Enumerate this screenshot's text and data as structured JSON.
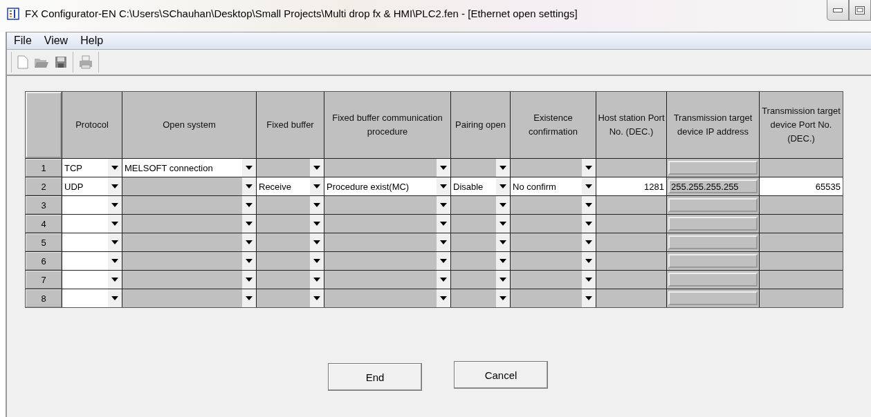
{
  "window": {
    "title": "FX Configurator-EN C:\\Users\\SChauhan\\Desktop\\Small Projects\\Multi drop fx & HMI\\PLC2.fen - [Ethernet open settings]"
  },
  "menu": [
    "File",
    "View",
    "Help"
  ],
  "table": {
    "columns": [
      {
        "label": "Protocol",
        "kind": "combo"
      },
      {
        "label": "Open system",
        "kind": "combo"
      },
      {
        "label": "Fixed buffer",
        "kind": "combo"
      },
      {
        "label": "Fixed buffer communication procedure",
        "kind": "combo"
      },
      {
        "label": "Pairing open",
        "kind": "combo"
      },
      {
        "label": "Existence confirmation",
        "kind": "combo"
      },
      {
        "label": "Host station Port No. (DEC.)",
        "kind": "number"
      },
      {
        "label": "Transmission target device IP address",
        "kind": "ip"
      },
      {
        "label": "Transmission target device Port No. (DEC.)",
        "kind": "number"
      }
    ],
    "rows": [
      {
        "number": "1",
        "cells": [
          {
            "value": "TCP",
            "enabled": true
          },
          {
            "value": "MELSOFT connection",
            "enabled": true
          },
          {
            "enabled": false
          },
          {
            "enabled": false
          },
          {
            "enabled": false
          },
          {
            "enabled": false
          },
          {
            "enabled": false
          },
          {
            "enabled": false
          },
          {
            "enabled": false
          }
        ]
      },
      {
        "number": "2",
        "cells": [
          {
            "value": "UDP",
            "enabled": true
          },
          {
            "enabled": false
          },
          {
            "value": "Receive",
            "enabled": true
          },
          {
            "value": "Procedure exist(MC)",
            "enabled": true
          },
          {
            "value": "Disable",
            "enabled": true
          },
          {
            "value": "No confirm",
            "enabled": true
          },
          {
            "value": "1281",
            "enabled": true
          },
          {
            "value": "255.255.255.255",
            "enabled": false
          },
          {
            "value": "65535",
            "enabled": true
          }
        ]
      },
      {
        "number": "3",
        "cells": [
          {
            "enabled": true
          },
          {
            "enabled": false
          },
          {
            "enabled": false
          },
          {
            "enabled": false
          },
          {
            "enabled": false
          },
          {
            "enabled": false
          },
          {
            "enabled": false
          },
          {
            "enabled": false
          },
          {
            "enabled": false
          }
        ]
      },
      {
        "number": "4",
        "cells": [
          {
            "enabled": true
          },
          {
            "enabled": false
          },
          {
            "enabled": false
          },
          {
            "enabled": false
          },
          {
            "enabled": false
          },
          {
            "enabled": false
          },
          {
            "enabled": false
          },
          {
            "enabled": false
          },
          {
            "enabled": false
          }
        ]
      },
      {
        "number": "5",
        "cells": [
          {
            "enabled": true
          },
          {
            "enabled": false
          },
          {
            "enabled": false
          },
          {
            "enabled": false
          },
          {
            "enabled": false
          },
          {
            "enabled": false
          },
          {
            "enabled": false
          },
          {
            "enabled": false
          },
          {
            "enabled": false
          }
        ]
      },
      {
        "number": "6",
        "cells": [
          {
            "enabled": true
          },
          {
            "enabled": false
          },
          {
            "enabled": false
          },
          {
            "enabled": false
          },
          {
            "enabled": false
          },
          {
            "enabled": false
          },
          {
            "enabled": false
          },
          {
            "enabled": false
          },
          {
            "enabled": false
          }
        ]
      },
      {
        "number": "7",
        "cells": [
          {
            "enabled": true
          },
          {
            "enabled": false
          },
          {
            "enabled": false
          },
          {
            "enabled": false
          },
          {
            "enabled": false
          },
          {
            "enabled": false
          },
          {
            "enabled": false
          },
          {
            "enabled": false
          },
          {
            "enabled": false
          }
        ]
      },
      {
        "number": "8",
        "cells": [
          {
            "enabled": true
          },
          {
            "enabled": false
          },
          {
            "enabled": false
          },
          {
            "enabled": false
          },
          {
            "enabled": false
          },
          {
            "enabled": false
          },
          {
            "enabled": false
          },
          {
            "enabled": false
          },
          {
            "enabled": false
          }
        ]
      }
    ]
  },
  "buttons": [
    "End",
    "Cancel"
  ]
}
